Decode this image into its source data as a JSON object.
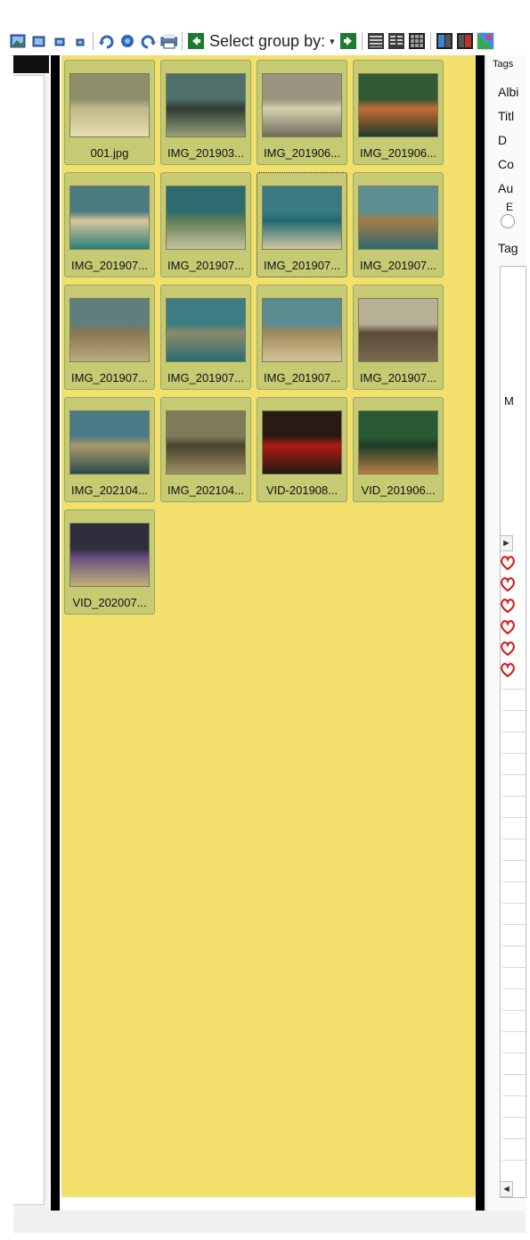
{
  "toolbar": {
    "select_group_label": "Select group by:",
    "buttons": [
      {
        "name": "thumb-size-xl-icon"
      },
      {
        "name": "thumb-size-l-icon"
      },
      {
        "name": "thumb-size-m-icon"
      },
      {
        "name": "thumb-size-s-icon"
      },
      {
        "name": "rotate-left-icon"
      },
      {
        "name": "rotate-icon"
      },
      {
        "name": "rotate-right-icon"
      },
      {
        "name": "print-icon"
      },
      {
        "name": "back-icon"
      }
    ],
    "after_buttons": [
      {
        "name": "forward-icon"
      },
      {
        "name": "view-details-icon"
      },
      {
        "name": "view-list-icon"
      },
      {
        "name": "view-grid-icon"
      },
      {
        "name": "view-split-left-icon"
      },
      {
        "name": "view-split-right-icon"
      },
      {
        "name": "google-maps-icon"
      }
    ]
  },
  "thumbnails": [
    {
      "label": "001.jpg",
      "colors": [
        "#8d8f6a",
        "#c0b88c",
        "#e6ddb0"
      ]
    },
    {
      "label": "IMG_201903...",
      "colors": [
        "#4f6f6b",
        "#2c3b33",
        "#9aa07a"
      ]
    },
    {
      "label": "IMG_201906...",
      "colors": [
        "#9a9480",
        "#d6cfb0",
        "#6e6d5b"
      ]
    },
    {
      "label": "IMG_201906...",
      "colors": [
        "#2f5a34",
        "#c56a35",
        "#1e3b27"
      ]
    },
    {
      "label": "IMG_201907...",
      "colors": [
        "#4b7a7f",
        "#d8c79c",
        "#2a7e7a"
      ]
    },
    {
      "label": "IMG_201907...",
      "colors": [
        "#2e6b70",
        "#5f7f55",
        "#c8c2a0"
      ]
    },
    {
      "label": "IMG_201907...",
      "colors": [
        "#3a7a82",
        "#226874",
        "#d0c9a2"
      ]
    },
    {
      "label": "IMG_201907...",
      "colors": [
        "#5f8f93",
        "#a47a45",
        "#2d6971"
      ]
    },
    {
      "label": "IMG_201907...",
      "colors": [
        "#5f7f7e",
        "#8c7650",
        "#b9ac83"
      ]
    },
    {
      "label": "IMG_201907...",
      "colors": [
        "#3e7c84",
        "#8a8b6a",
        "#2b6c75"
      ]
    },
    {
      "label": "IMG_201907...",
      "colors": [
        "#5a8b90",
        "#a18b5a",
        "#d2c39a"
      ]
    },
    {
      "label": "IMG_201907...",
      "colors": [
        "#b9b098",
        "#5a4a38",
        "#7a6a52"
      ]
    },
    {
      "label": "IMG_202104...",
      "colors": [
        "#4b7a86",
        "#aa9a6c",
        "#2b4a4d"
      ]
    },
    {
      "label": "IMG_202104...",
      "colors": [
        "#7f7a5a",
        "#46432e",
        "#9f8f64"
      ]
    },
    {
      "label": "VID-201908...",
      "colors": [
        "#2a1a14",
        "#b01a12",
        "#1e1a12"
      ]
    },
    {
      "label": "VID_201906...",
      "colors": [
        "#2a5a34",
        "#1e3b27",
        "#b87d46"
      ]
    },
    {
      "label": "VID_202007...",
      "colors": [
        "#2f2e3e",
        "#6a5080",
        "#c2b07a"
      ]
    }
  ],
  "right_panel": {
    "tab_label": "Tags",
    "fields": [
      "Albi",
      "Titl",
      "D",
      "Co",
      "Au",
      "E",
      "Tag"
    ],
    "m_label": "M",
    "scroll_arrow": "►",
    "scroll_arrow_down": "◄",
    "heart_count": 6
  }
}
